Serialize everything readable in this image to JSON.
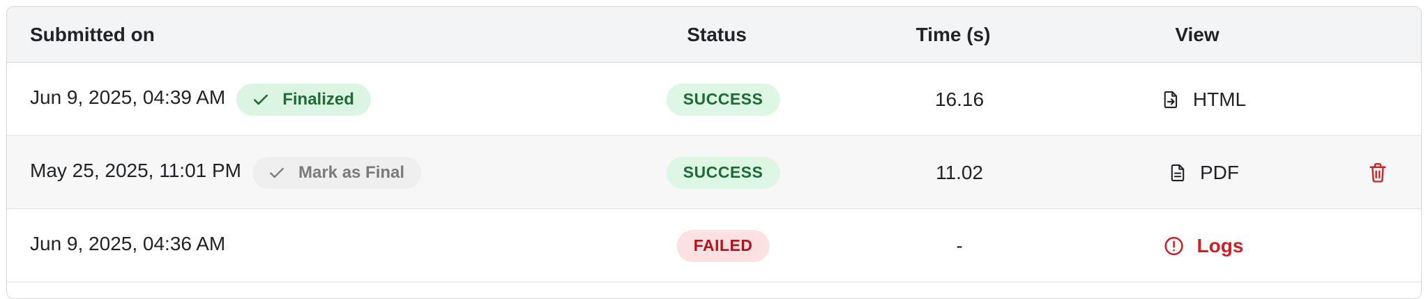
{
  "columns": {
    "submitted": "Submitted on",
    "status": "Status",
    "time": "Time (s)",
    "view": "View"
  },
  "rows": [
    {
      "submitted": "Jun 9, 2025, 04:39 AM",
      "final_chip": "Finalized",
      "status": "SUCCESS",
      "time": "16.16",
      "view_label": "HTML",
      "view_icon": "file-export-icon"
    },
    {
      "submitted": "May 25, 2025, 11:01 PM",
      "final_chip": "Mark as Final",
      "status": "SUCCESS",
      "time": "11.02",
      "view_label": "PDF",
      "view_icon": "document-icon",
      "action_icon": "trash-icon"
    },
    {
      "submitted": "Jun 9, 2025, 04:36 AM",
      "status": "FAILED",
      "time": "-",
      "view_label": "Logs",
      "view_icon": "alert-circle-icon"
    }
  ],
  "colors": {
    "success_bg": "#ddf7e4",
    "success_text": "#1a6b34",
    "failed_bg": "#fde1e1",
    "failed_text": "#b3141b",
    "danger": "#cc1f26"
  }
}
